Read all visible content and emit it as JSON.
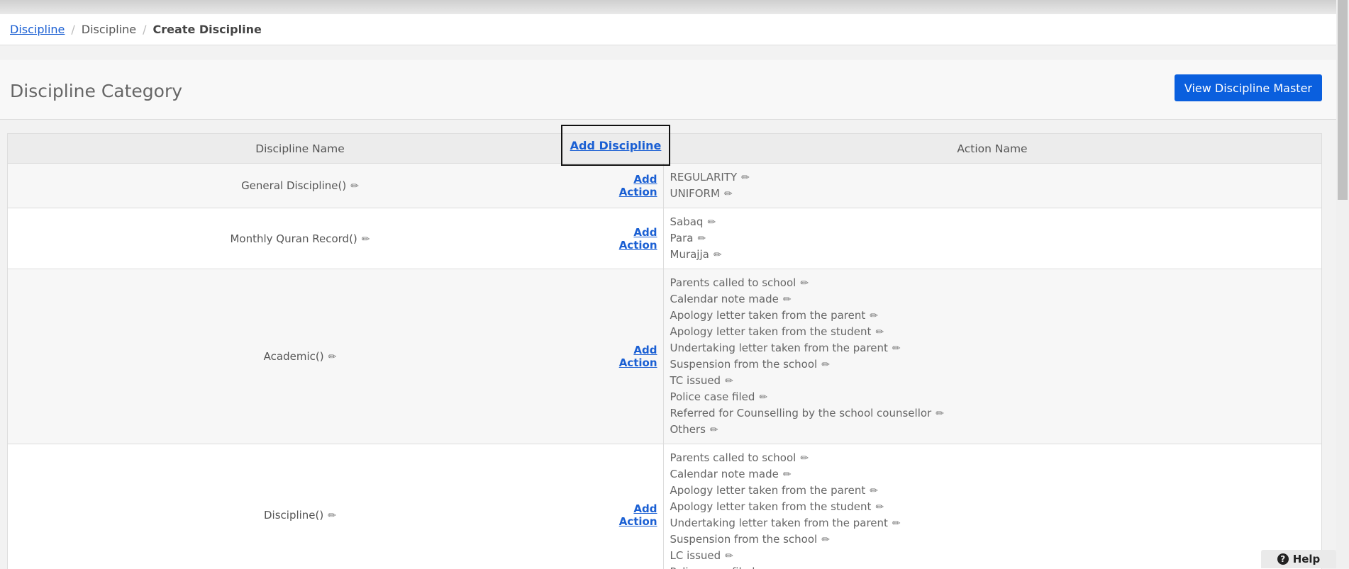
{
  "breadcrumb": {
    "items": [
      "Discipline",
      "Discipline",
      "Create Discipline"
    ]
  },
  "panel": {
    "title": "Discipline Category",
    "view_master_label": "View Discipline Master"
  },
  "table": {
    "headers": {
      "name": "Discipline Name",
      "add": "Add Discipline",
      "actions": "Action Name"
    },
    "add_action_label": "Add Action",
    "rows": [
      {
        "name": "General Discipline()",
        "actions": [
          "REGULARITY",
          "UNIFORM"
        ]
      },
      {
        "name": "Monthly Quran Record()",
        "actions": [
          "Sabaq",
          "Para",
          "Murajja"
        ]
      },
      {
        "name": "Academic()",
        "actions": [
          "Parents called to school",
          "Calendar note made",
          "Apology letter taken from the parent",
          "Apology letter taken from the student",
          "Undertaking letter taken from the parent",
          "Suspension from the school",
          "TC issued",
          "Police case filed",
          "Referred for Counselling by the school counsellor",
          "Others"
        ]
      },
      {
        "name": "Discipline()",
        "actions": [
          "Parents called to school",
          "Calendar note made",
          "Apology letter taken from the parent",
          "Apology letter taken from the student",
          "Undertaking letter taken from the parent",
          "Suspension from the school",
          "LC issued",
          "Police case filed"
        ]
      }
    ]
  },
  "help": {
    "label": "Help"
  },
  "icons": {
    "edit": "pencil-icon",
    "help": "question-circle-icon"
  },
  "colors": {
    "link": "#1a5fd3",
    "primary_button": "#0a5fde"
  }
}
